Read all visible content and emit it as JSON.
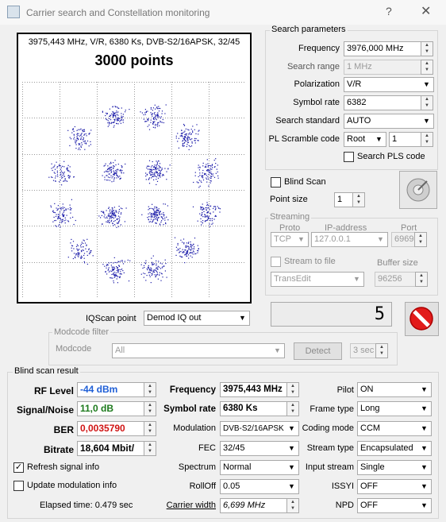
{
  "title": "Carrier search and Constellation monitoring",
  "help": "?",
  "close": "✕",
  "plot": {
    "info": "3975,443 MHz, V/R, 6380 Ks, DVB-S2/16APSK, 32/45",
    "points": "3000 points"
  },
  "search": {
    "legend": "Search parameters",
    "freq_l": "Frequency",
    "freq": "3976,000 MHz",
    "range_l": "Search range",
    "range": "1 MHz",
    "pol_l": "Polarization",
    "pol": "V/R",
    "sr_l": "Symbol rate",
    "sr": "6382",
    "std_l": "Search standard",
    "std": "AUTO",
    "pl_l": "PL Scramble code",
    "pl_mode": "Root",
    "pl_val": "1",
    "pls_l": "Search PLS code"
  },
  "blind": {
    "label": "Blind Scan",
    "ps_l": "Point size",
    "ps": "1"
  },
  "stream": {
    "legend": "Streaming",
    "proto_l": "Proto",
    "ip_l": "IP-address",
    "port_l": "Port",
    "proto": "TCP",
    "ip": "127.0.0.1",
    "port": "6969",
    "file_l": "Stream to file",
    "buf_l": "Buffer size",
    "file": "TransEdit",
    "buf": "96256"
  },
  "iq": {
    "label": "IQScan point",
    "value": "Demod IQ out"
  },
  "counter": "5",
  "modcode": {
    "legend": "Modcode filter",
    "label": "Modcode",
    "value": "All",
    "detect": "Detect",
    "sec": "3 sec"
  },
  "result": {
    "legend": "Blind scan result",
    "rf_l": "RF Level",
    "rf": "-44 dBm",
    "sn_l": "Signal/Noise",
    "sn": "11,0 dB",
    "ber_l": "BER",
    "ber": "0,0035790",
    "br_l": "Bitrate",
    "br": "18,604 Mbit/",
    "refresh": "Refresh signal info",
    "update": "Update modulation info",
    "elapsed": "Elapsed time: 0.479 sec",
    "freq_l": "Frequency",
    "freq": "3975,443 MHz",
    "sr_l": "Symbol rate",
    "sr": "6380 Ks",
    "mod_l": "Modulation",
    "mod": "DVB-S2/16APSK",
    "fec_l": "FEC",
    "fec": "32/45",
    "spec_l": "Spectrum",
    "spec": "Normal",
    "roll_l": "RollOff",
    "roll": "0.05",
    "cw_l": "Carrier width",
    "cw": "6,699 MHz",
    "pilot_l": "Pilot",
    "pilot": "ON",
    "frame_l": "Frame type",
    "frame": "Long",
    "coding_l": "Coding mode",
    "coding": "CCM",
    "stype_l": "Stream type",
    "stype": "Encapsulated",
    "input_l": "Input stream",
    "input": "Single",
    "issyi_l": "ISSYI",
    "issyi": "OFF",
    "npd_l": "NPD",
    "npd": "OFF"
  },
  "colors": {
    "rf": "#1f5fd6",
    "sn": "#1c7a1c",
    "ber": "#d01515",
    "points": "#1a1aa8"
  }
}
